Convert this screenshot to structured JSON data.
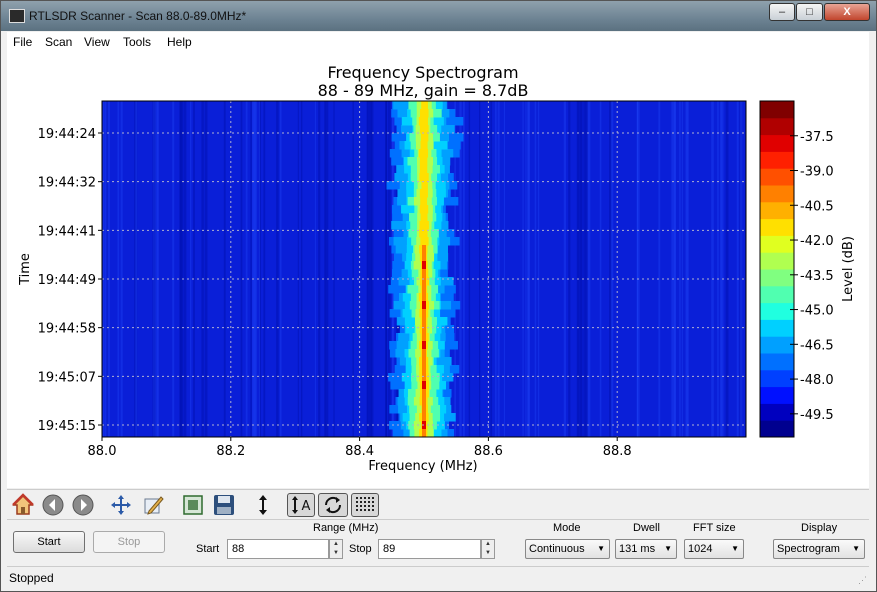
{
  "window": {
    "title": "RTLSDR Scanner - Scan 88.0-89.0MHz*",
    "min_label": "–",
    "max_label": "□",
    "close_label": "X"
  },
  "menu": [
    {
      "label": "File"
    },
    {
      "label": "Scan"
    },
    {
      "label": "View"
    },
    {
      "label": "Tools"
    },
    {
      "label": "Help"
    }
  ],
  "chart_data": {
    "type": "heatmap",
    "title": "Frequency Spectrogram",
    "subtitle": "88 - 89 MHz, gain = 8.7dB",
    "xlabel": "Frequency (MHz)",
    "ylabel": "Time",
    "xlim": [
      88.0,
      89.0
    ],
    "xticks": [
      "88.0",
      "88.2",
      "88.4",
      "88.6",
      "88.8"
    ],
    "xtick_values": [
      88.0,
      88.2,
      88.4,
      88.6,
      88.8
    ],
    "yticks": [
      "19:44:24",
      "19:44:32",
      "19:44:41",
      "19:44:49",
      "19:44:58",
      "19:45:07",
      "19:45:15"
    ],
    "signal_center_mhz": 88.5,
    "grid": true,
    "colorbar": {
      "label": "Level (dB)",
      "ticks": [
        "-37.5",
        "-39.0",
        "-40.5",
        "-42.0",
        "-43.5",
        "-45.0",
        "-46.5",
        "-48.0",
        "-49.5"
      ],
      "tick_values": [
        -37.5,
        -39.0,
        -40.5,
        -42.0,
        -43.5,
        -45.0,
        -46.5,
        -48.0,
        -49.5
      ],
      "range": [
        -50.5,
        -36.0
      ],
      "colors": [
        "#00008f",
        "#0000bf",
        "#0010ff",
        "#0040ff",
        "#0070ff",
        "#00a0ff",
        "#00d0ff",
        "#20ffe0",
        "#50ffb0",
        "#80ff80",
        "#b0ff50",
        "#e0ff20",
        "#ffe000",
        "#ffb000",
        "#ff8000",
        "#ff5000",
        "#ff2000",
        "#e00000",
        "#b00000",
        "#800000"
      ]
    }
  },
  "toolbar": {
    "icons": [
      "home-icon",
      "back-icon",
      "forward-icon",
      "pan-icon",
      "edit-icon",
      "fit-icon",
      "save-icon",
      "vertical-arrow-icon",
      "autoscale-icon",
      "refresh-icon",
      "grid-icon"
    ],
    "autoscale_letter": "A"
  },
  "controls": {
    "start_label": "Start",
    "stop_label": "Stop",
    "range_label": "Range (MHz)",
    "range_start_label": "Start",
    "range_start_value": "88",
    "range_stop_label": "Stop",
    "range_stop_value": "89",
    "mode_label": "Mode",
    "mode_value": "Continuous",
    "dwell_label": "Dwell",
    "dwell_value": "131 ms",
    "fft_label": "FFT size",
    "fft_value": "1024",
    "display_label": "Display",
    "display_value": "Spectrogram"
  },
  "status": {
    "text": "Stopped"
  }
}
